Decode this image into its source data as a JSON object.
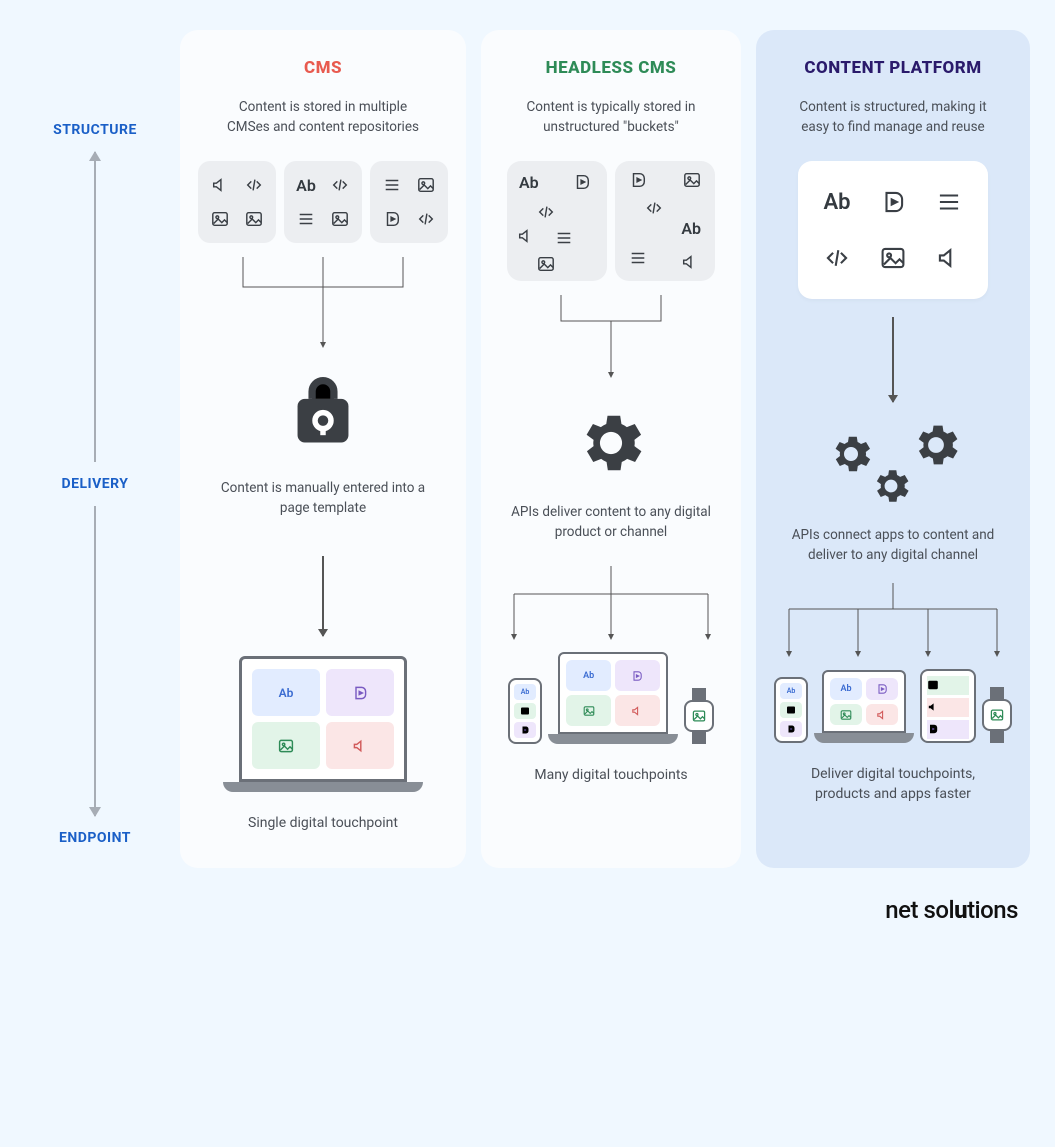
{
  "row_labels": {
    "structure": "STRUCTURE",
    "delivery": "DELIVERY",
    "endpoint": "ENDPOINT"
  },
  "columns": {
    "cms": {
      "title": "CMS",
      "structure_text": "Content is stored in multiple CMSes and content repositories",
      "delivery_text": "Content is manually entered into a page template",
      "endpoint_text": "Single digital touchpoint"
    },
    "headless": {
      "title": "HEADLESS CMS",
      "structure_text": "Content is typically stored in unstructured \"buckets\"",
      "delivery_text": "APIs deliver content to any digital product or channel",
      "endpoint_text": "Many digital touchpoints"
    },
    "platform": {
      "title": "CONTENT PLATFORM",
      "structure_text": "Content is structured, making it easy to find manage and reuse",
      "delivery_text": "APIs connect apps to content and deliver to any digital channel",
      "endpoint_text": "Deliver digital touchpoints, products and apps faster"
    }
  },
  "glyphs": {
    "ab": "Ab"
  },
  "footer": {
    "brand_prefix": "net sol",
    "brand_suffix": "tions"
  },
  "colors": {
    "cms": "#e85a4f",
    "headless": "#2e8b57",
    "platform": "#2a1a6b",
    "label": "#1a5fc7"
  }
}
